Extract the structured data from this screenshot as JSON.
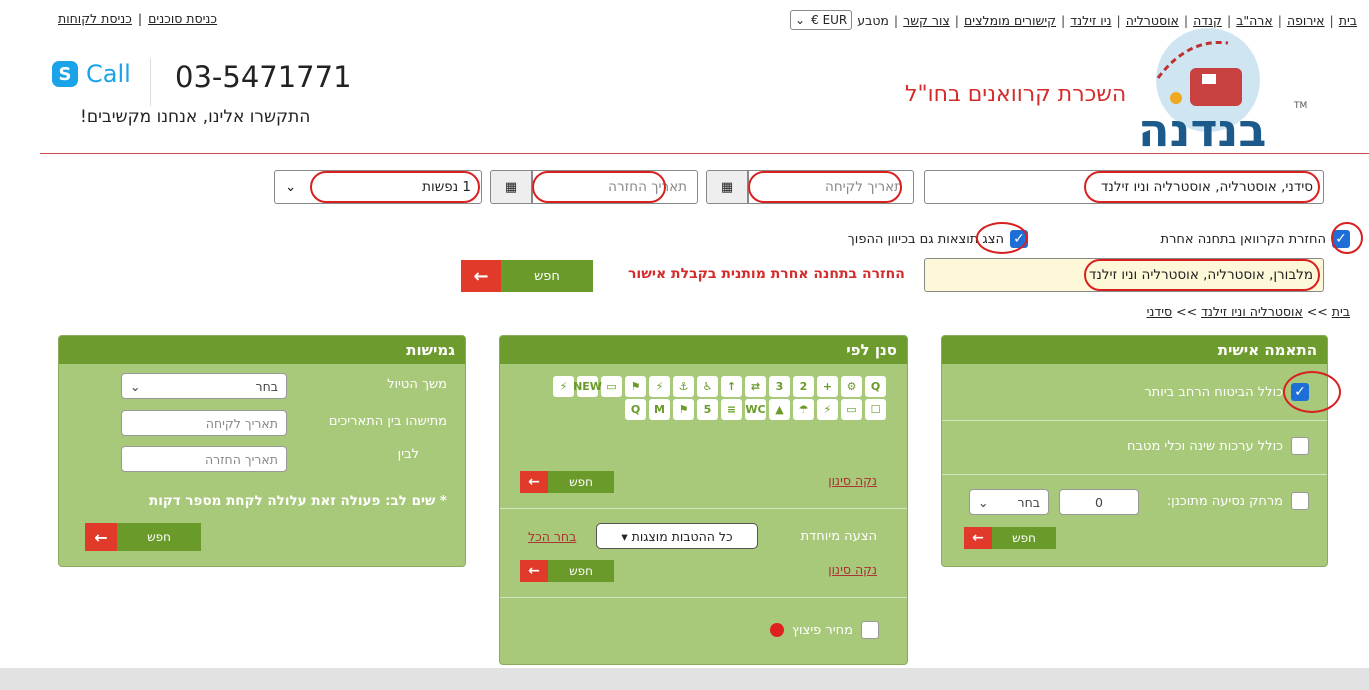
{
  "topnav": {
    "links": [
      "בית",
      "אירופה",
      "ארה\"ב",
      "קנדה",
      "אוסטרליה",
      "ניו זילנד",
      "קישורים מומלצים",
      "צור קשר"
    ],
    "currency_label": "מטבע",
    "currency_value": "EUR €"
  },
  "account": {
    "agents_login": "כניסת סוכנים",
    "customer_login": "כניסת לקוחות"
  },
  "brand": {
    "logo_text": "בנדנה",
    "tm": "TM",
    "tagline": "השכרת קרוואנים בחו\"ל"
  },
  "contact": {
    "phone": "03-5471771",
    "skype_label": "Call",
    "listen": "התקשרו אלינו, אנחנו מקשיבים!"
  },
  "search": {
    "pickup_location": "סידני, אוסטרליה, אוסטרליה וניו זילנד",
    "pickup_date_placeholder": "תאריך לקיחה",
    "return_date_placeholder": "תאריך החזרה",
    "passengers": "1 נפשות",
    "return_other_label": "החזרת הקרוואן בתחנה אחרת",
    "show_reverse_label": "הצג תוצאות גם בכיוון ההפוך",
    "return_location": "מלבורן, אוסטרליה, אוסטרליה וניו זילנד",
    "approval_notice": "החזרה בתחנה אחרת מותנית בקבלת אישור",
    "search_button": "חפש"
  },
  "breadcrumb": {
    "home": "בית",
    "region": "אוסטרליה וניו זילנד",
    "city": "סידני",
    "sep": ">>"
  },
  "personal": {
    "title": "התאמה אישית",
    "full_insurance": "כולל הביטוח הרחב ביותר",
    "bedding": "כולל ערכות שינה וכלי מטבח",
    "distance_label": "מרחק נסיעה מתוכנן:",
    "distance_value": "0",
    "unit_select": "בחר",
    "search_button": "חפש"
  },
  "filter": {
    "title": "סנן לפי",
    "clear": "נקה סינון",
    "search_button": "חפש",
    "special_label": "הצעה מיוחדת",
    "special_select": "כל ההטבות מוצגות ▾",
    "select_all": "בחר הכל",
    "clear2": "נקה סינון",
    "search_button2": "חפש",
    "hot_price": "מחיר פיצוץ",
    "icons": [
      "Q",
      "⚙",
      "+",
      "2",
      "3",
      "⇄",
      "↑",
      "♿",
      "⚓",
      "⚡",
      "⚑",
      "▭",
      "NEW",
      "⚡",
      "☐",
      "▭",
      "⚡",
      "☂",
      "▲",
      "WC",
      "≡",
      "5",
      "⚑",
      "M",
      "Q"
    ]
  },
  "flex": {
    "title": "גמישות",
    "trip_length_label": "משך הטיול",
    "trip_length_select": "בחר",
    "between_label": "מתישהו בין התאריכים",
    "pickup_placeholder": "תאריך לקיחה",
    "and_label": "לבין",
    "return_placeholder": "תאריך החזרה",
    "note": "* שים לב: פעולה זאת עלולה לקחת מספר דקות",
    "search_button": "חפש"
  }
}
